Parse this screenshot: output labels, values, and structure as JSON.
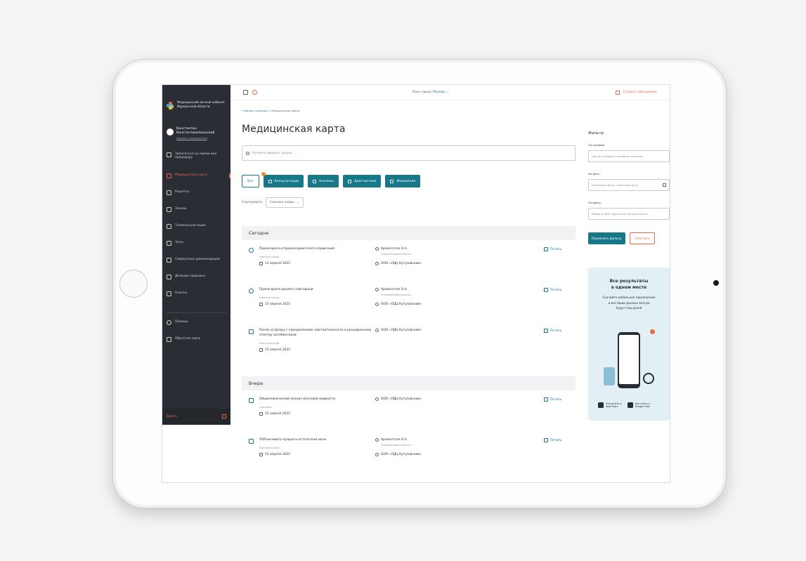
{
  "sidebar": {
    "brand": "Медицинский личный кабинет Мурманской области",
    "user_name": "Константин Константинопольский",
    "user_switch": "Сменить пользователя",
    "menu": [
      {
        "label": "Записаться на прием или процедуру",
        "icon": "calendar-icon",
        "active": false
      },
      {
        "label": "Медицинская карта",
        "icon": "medical-card-icon",
        "active": true
      },
      {
        "label": "Рецепты",
        "icon": "prescription-icon",
        "active": false
      },
      {
        "label": "Заказы",
        "icon": "orders-icon",
        "active": false
      },
      {
        "label": "Телеконсультации",
        "icon": "headset-icon",
        "active": false
      },
      {
        "label": "Чаты",
        "icon": "chat-icon",
        "active": false
      },
      {
        "label": "Совокупные рекомендации",
        "icon": "document-icon",
        "active": false
      },
      {
        "label": "Дневник здоровья",
        "icon": "heart-icon",
        "active": false
      },
      {
        "label": "Анкеты",
        "icon": "clipboard-icon",
        "active": false
      }
    ],
    "help": "Помощь",
    "feedback": "Обратная связь",
    "logout": "Выйти"
  },
  "topbar": {
    "city_label": "Ваш город:",
    "city_value": "Москва",
    "create_request": "Создать обращение"
  },
  "main": {
    "breadcrumb_home": "Главная страница",
    "breadcrumb_current": "Медицинская карта",
    "title": "Медицинская карта",
    "search_placeholder": "Начните вводить запрос ...",
    "chips": {
      "all": "Все",
      "consultations": "Консультации",
      "analyses": "Анализы",
      "diagnostics": "Диагностика",
      "measurements": "Измерения"
    },
    "sort_label": "Сортировать",
    "sort_value": "Сначала новые",
    "groups": [
      {
        "title": "Сегодня",
        "items": [
          {
            "title": "Прием врача-оториноларинголога первичный",
            "type": "Консультация",
            "date": "13 апреля 2021",
            "doctor": "Арамсатсян О.А.",
            "specialty": "Оториноларингология",
            "clinic": "ООО «ЛДЦ Кутузовский»",
            "print": "Печать"
          },
          {
            "title": "Прием врача-уролога повторный",
            "type": "Консультация",
            "date": "13 апреля 2021",
            "doctor": "Арамсатсян О.А.",
            "specialty": "Оториноларингология",
            "clinic": "ООО «ЛДЦ Кутузовский»",
            "print": "Печать"
          },
          {
            "title": "Посев на флору с определением чувствительности к расширенному спектру антибиотиков",
            "type": "Консультация",
            "date": "13 апреля 2021",
            "clinic": "ООО «ЛДЦ Кутузовский»",
            "print": "Печать"
          }
        ]
      },
      {
        "title": "Вчера",
        "items": [
          {
            "title": "Общеклинический анализ мозговой жидкости",
            "type": "Анализы",
            "date": "12 апреля 2021",
            "clinic": "ООО «ЛДЦ Кутузовский»",
            "print": "Печать"
          },
          {
            "title": "УЗИ мочевого пузыря и остаточной мочи",
            "type": "Консультация",
            "date": "12 апреля 2021",
            "doctor": "Арамсатсян О.А.",
            "specialty": "Оториноларингология",
            "clinic": "ООО «ЛДЦ Кутузовский»",
            "print": "Печать"
          }
        ]
      }
    ]
  },
  "filter": {
    "title": "Фильтр",
    "clinic_label": "По клинике",
    "clinic_placeholder": "Начните вводить название клиники",
    "date_label": "По дате",
    "date_placeholder": "Начальная дата - Конечная дата",
    "doctor_label": "По врачу",
    "doctor_placeholder": "Введите ФИО врача или специальность",
    "apply": "Применить фильтр",
    "clear": "Очистить"
  },
  "promo": {
    "title_line1": "Все результаты",
    "title_line2": "в одном месте",
    "text_line1": "Скачайте мобильное приложение",
    "text_line2": "и все ваши данные всегда",
    "text_line3": "будут под рукой",
    "appstore_small": "Загрузите в",
    "appstore": "App Store",
    "googleplay_small": "Доступно в",
    "googleplay": "Google Play"
  },
  "colors": {
    "accent": "#17788a",
    "danger": "#e8684a",
    "sidebar": "#2a2d33"
  }
}
